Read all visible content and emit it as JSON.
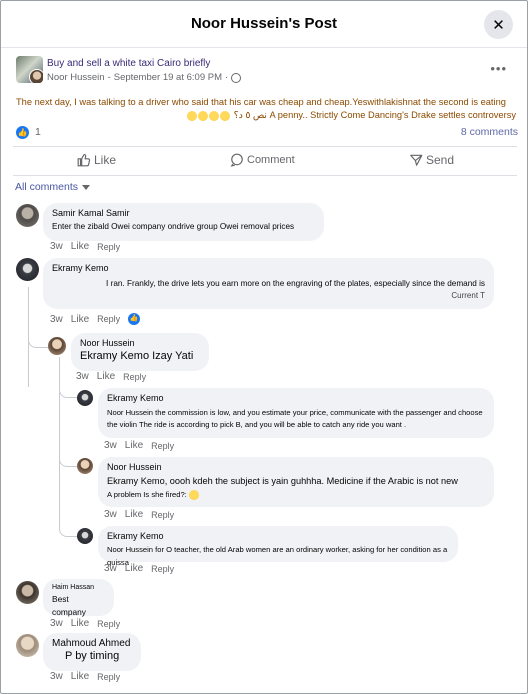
{
  "header": {
    "title": "Noor Hussein's Post",
    "close_glyph": "✕"
  },
  "post": {
    "group": "Buy and sell a white taxi Cairo briefly",
    "author": "Noor Hussein",
    "date": "September 19 at 6:09 PM",
    "sep": "-",
    "dot": "·",
    "more_glyph": "•••",
    "text_line1": "The next day, I was talking to a driver who said that his car was cheap and cheap.Yeswithlakishnat the second is eating",
    "text_line2": "نص ٥ د؟ A penny.. Strictly Come Dancing's Drake settles controversy",
    "like_count": "1",
    "comments_count": "8 comments"
  },
  "actions": {
    "like": "Like",
    "comment": "Comment",
    "send": "Send"
  },
  "filter": {
    "label": "All comments"
  },
  "comments": [
    {
      "name": "Samir Kamal Samir",
      "text": "Enter the zibald Owei company ondrive group Owei removal prices",
      "time": "3w",
      "like": "Like",
      "reply": "Reply"
    },
    {
      "name": "Ekramy Kemo",
      "text": "I ran. Frankly, the drive lets you earn more on the engraving of the plates, especially since the demand is",
      "text2": "Current T",
      "time": "3w",
      "like": "Like",
      "reply": "Reply"
    },
    {
      "name": "Noor Hussein",
      "text": "Ekramy Kemo Izay Yati",
      "time": "3w",
      "like": "Like",
      "reply": "Reply"
    },
    {
      "name": "Ekramy Kemo",
      "text": "Noor Hussein the commission is low, and you estimate your price, communicate with the passenger and choose",
      "text2": "the violin The ride is according to pick B, and you will be able to catch any ride you want .",
      "time": "3w",
      "like": "Like",
      "reply": "Reply"
    },
    {
      "name": "Noor Hussein",
      "text": "Ekramy Kemo, oooh kdeh the subject is yain guhhha. Medicine if the Arabic is not new",
      "text2": "A problem Is she fired?:",
      "time": "3w",
      "like": "Like",
      "reply": "Reply"
    },
    {
      "name": "Ekramy Kemo",
      "text": "Noor Hussein for O teacher, the old Arab women are an ordinary worker, asking for her condition as a quissa",
      "time": "3w",
      "like": "Like",
      "reply": "Reply"
    },
    {
      "name": "Haim Hassan",
      "text": "Best company",
      "time": "3w",
      "like": "Like",
      "reply": "Reply"
    },
    {
      "name": "Mahmoud Ahmed",
      "text": "P by timing",
      "time": "3w",
      "like": "Like",
      "reply": "Reply"
    }
  ]
}
